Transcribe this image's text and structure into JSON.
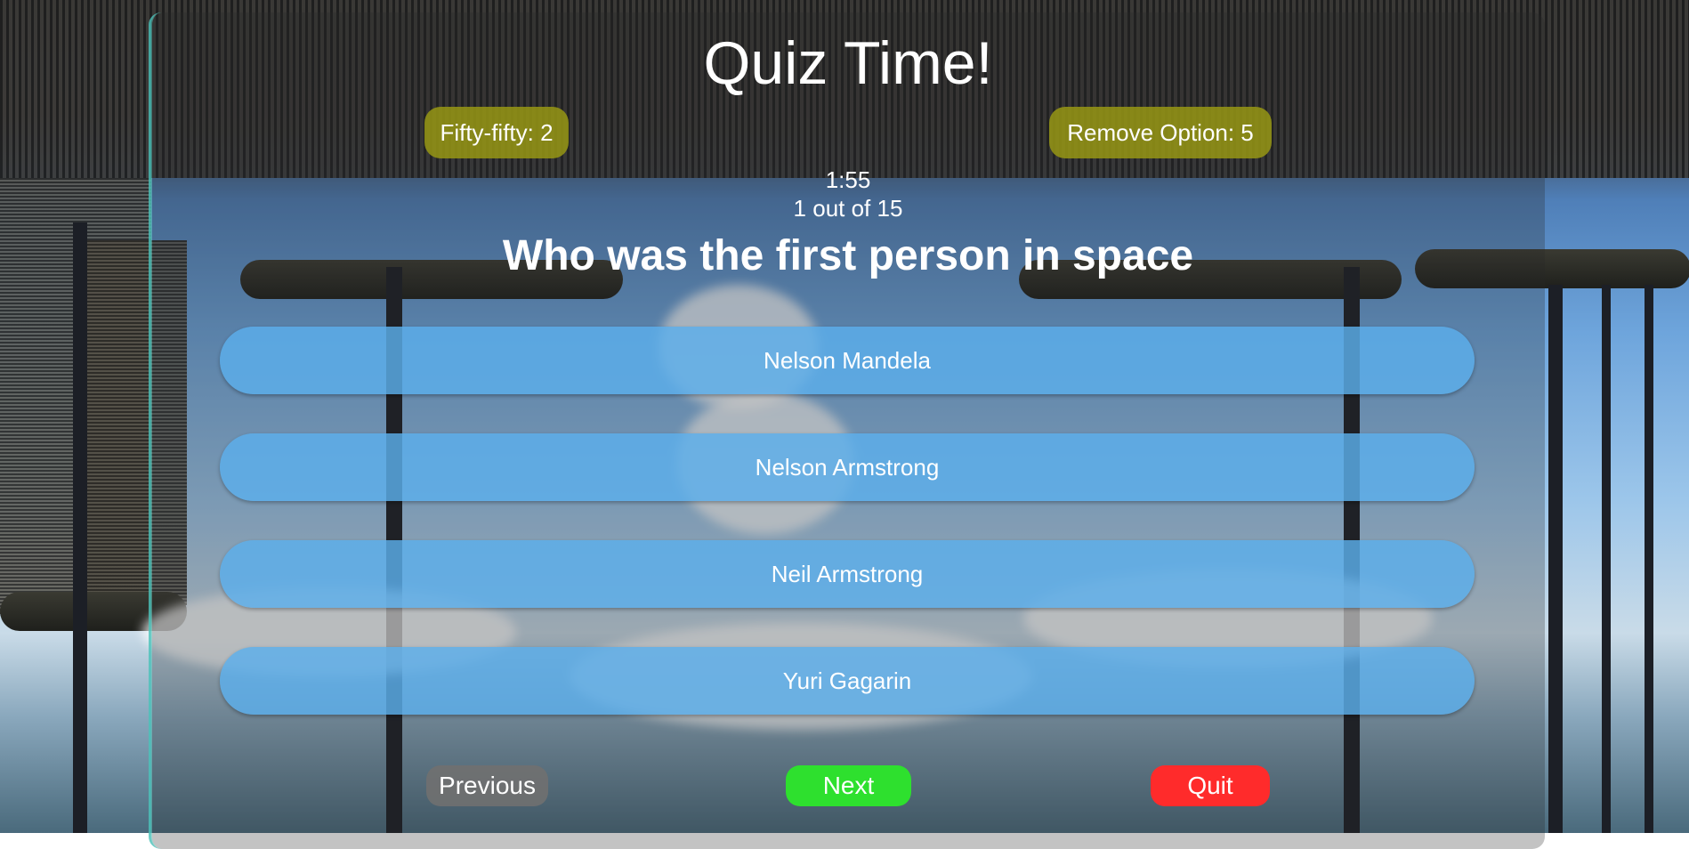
{
  "quiz": {
    "title": "Quiz Time!",
    "lifelines": {
      "fifty_fifty": "Fifty-fifty: 2",
      "remove_option": "Remove Option: 5"
    },
    "timer": "1:55",
    "progress": "1 out of 15",
    "question": "Who was the first person in space",
    "options": [
      "Nelson Mandela",
      "Nelson Armstrong",
      "Neil Armstrong",
      "Yuri Gagarin"
    ],
    "nav": {
      "previous": "Previous",
      "next": "Next",
      "quit": "Quit"
    }
  },
  "colors": {
    "lifeline": "#969614",
    "option": "#5cafeb",
    "previous": "#707070",
    "next": "#2ee02e",
    "quit": "#ff2b2b"
  }
}
